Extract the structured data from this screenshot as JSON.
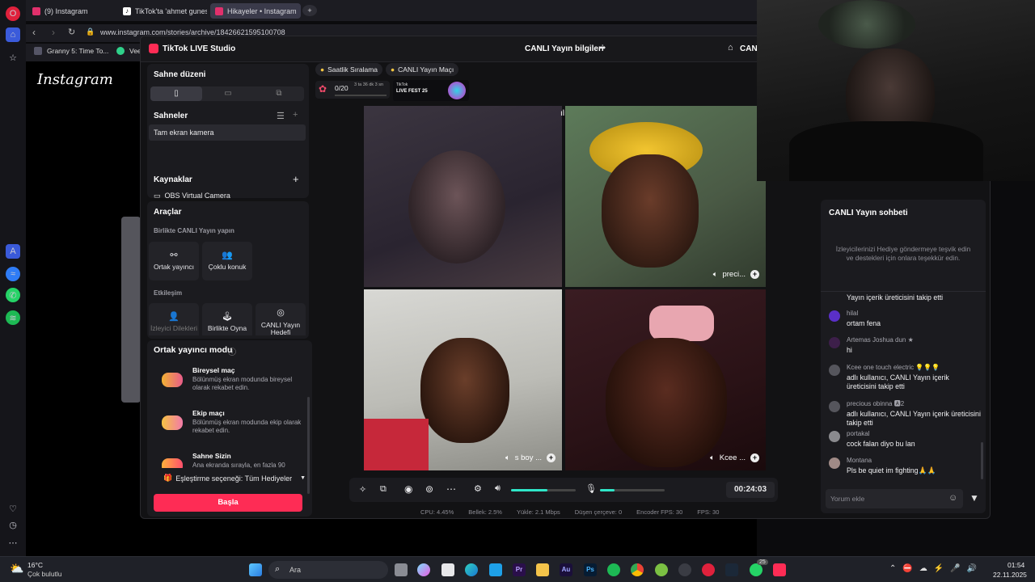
{
  "browser": {
    "tabs": [
      {
        "label": "(9) Instagram",
        "color": "#e1306c"
      },
      {
        "label": "TikTok'ta 'ahmet gunes' b",
        "color": "#111111"
      },
      {
        "label": "Hikayeler • Instagram",
        "color": "#e1306c"
      }
    ],
    "url": "www.instagram.com/stories/archive/18426621595100708",
    "bookmarks": [
      "Granny 5: Time To...",
      "Veel"
    ],
    "new_tab": "+"
  },
  "instagram": {
    "logo": "Instagram"
  },
  "studio": {
    "app_title": "TikTok LIVE Studio",
    "center_title": "CANLI Yayın bilgileri",
    "right_title": "CANL",
    "scene_panel": {
      "title": "Sahne düzeni",
      "scenes_title": "Sahneler",
      "scene_item": "Tam ekran kamera",
      "sources_title": "Kaynaklar",
      "source_item": "OBS Virtual Camera"
    },
    "tools": {
      "title": "Araçlar",
      "cohost_label": "Birlikte CANLI Yayın yapın",
      "btn_cohost": "Ortak yayıncı",
      "btn_multi": "Çoklu konuk",
      "engagement_label": "Etkileşim",
      "btn_viewer": "İzleyici Dilekleri",
      "btn_play": "Birlikte Oyna",
      "btn_goal": "CANLI Yayın Hedefi"
    },
    "cohost_mode": {
      "title": "Ortak yayıncı modu",
      "items": [
        {
          "title": "Bireysel maç",
          "desc": "Bölünmüş ekran modunda bireysel olarak rekabet edin."
        },
        {
          "title": "Ekip maçı",
          "desc": "Bölünmüş ekran modunda ekip olarak rekabet edin."
        },
        {
          "title": "Sahne Sizin",
          "desc": "Ana ekranda sırayla, en fazla 90"
        }
      ],
      "match_option": "Eşleştirme seçeneği: Tüm Hediyeler",
      "start_button": "Başla"
    },
    "top_pills": {
      "ranking": "Saatlik Sıralama",
      "match": "CANLI Yayın Maçı",
      "progress": "0/20",
      "timer": "3 ta 36 dk 3 sn",
      "fest": "LIVE FEST 25",
      "fest_small": "TikTok"
    },
    "tiles": [
      {
        "name": ""
      },
      {
        "name": "preci..."
      },
      {
        "name": "s boy ..."
      },
      {
        "name": "Kcee ..."
      }
    ],
    "controls": {
      "timer": "00:24:03"
    },
    "stats": {
      "cpu": "CPU: 4.45%",
      "memory": "Bellek: 2.5%",
      "upload": "Yükle: 2.1 Mbps",
      "dropped": "Düşen çerçeve: 0",
      "encoder": "Encoder FPS: 30",
      "fps": "FPS: 30"
    },
    "chat": {
      "title": "CANLI Yayın sohbeti",
      "notice": "İzleyicilerinizi Hediye göndermeye teşvik edin ve destekleri için onlara teşekkür edin.",
      "messages": [
        {
          "user": "",
          "text": "Yayın içerik üreticisini takip etti"
        },
        {
          "user": "hilal",
          "text": "ortam fena"
        },
        {
          "user": "Artemas Joshua dun ★",
          "text": "hi"
        },
        {
          "user": "Kcee one touch electric 💡💡💡",
          "text": "adlı kullanıcı, CANLI Yayın içerik üreticisini takip etti"
        },
        {
          "user": "precious obinna 🅰2",
          "text": "adlı kullanıcı, CANLI Yayın içerik üreticisini takip etti"
        },
        {
          "user": "portakal",
          "text": "cock falan diyo bu lan"
        },
        {
          "user": "Montana",
          "text": "Pls be quiet im fighting🙏🙏"
        }
      ],
      "input_placeholder": "Yorum ekle"
    }
  },
  "taskbar": {
    "weather_temp": "16°C",
    "weather_desc": "Çok bulutlu",
    "search": "Ara",
    "time": "01:54",
    "date": "22.11.2025",
    "badge": "25"
  }
}
